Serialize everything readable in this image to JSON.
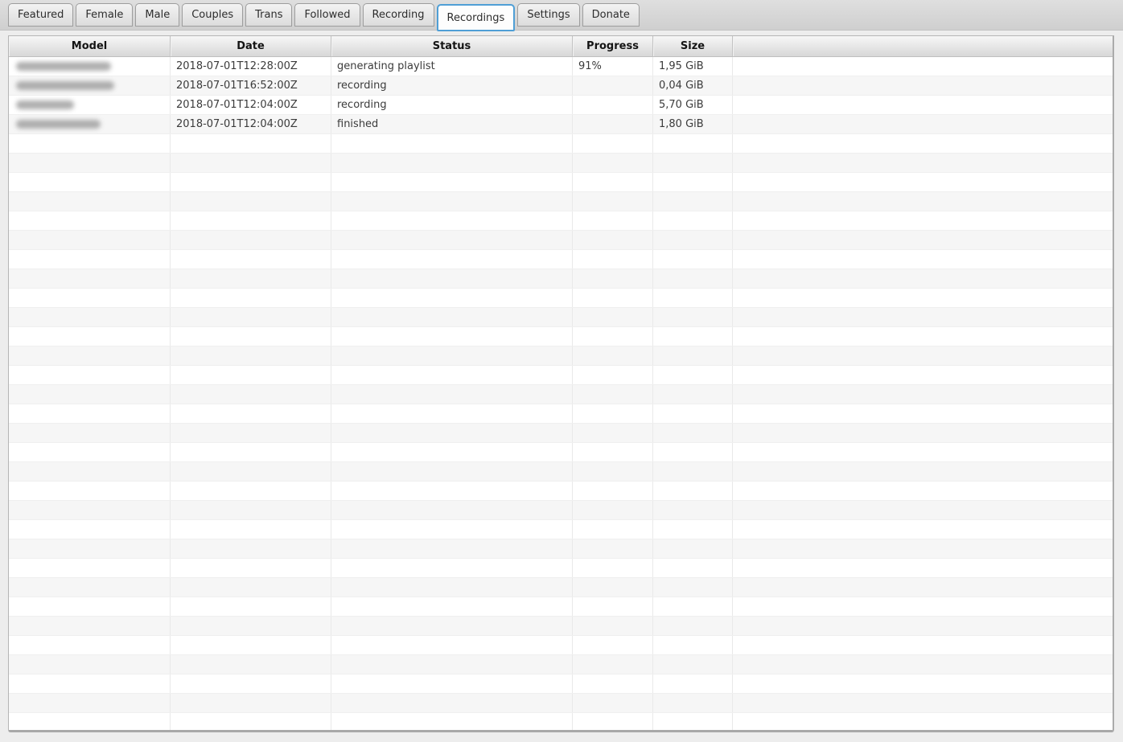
{
  "tabs": {
    "items": [
      {
        "label": "Featured",
        "active": false
      },
      {
        "label": "Female",
        "active": false
      },
      {
        "label": "Male",
        "active": false
      },
      {
        "label": "Couples",
        "active": false
      },
      {
        "label": "Trans",
        "active": false
      },
      {
        "label": "Followed",
        "active": false
      },
      {
        "label": "Recording",
        "active": false
      },
      {
        "label": "Recordings",
        "active": true
      },
      {
        "label": "Settings",
        "active": false
      },
      {
        "label": "Donate",
        "active": false
      }
    ]
  },
  "table": {
    "columns": [
      {
        "label": "Model"
      },
      {
        "label": "Date"
      },
      {
        "label": "Status"
      },
      {
        "label": "Progress"
      },
      {
        "label": "Size"
      },
      {
        "label": ""
      }
    ],
    "rows": [
      {
        "model": "",
        "model_redacted": true,
        "model_blob_width": 118,
        "date": "2018-07-01T12:28:00Z",
        "status": "generating playlist",
        "progress": "91%",
        "size": "1,95 GiB"
      },
      {
        "model": "",
        "model_redacted": true,
        "model_blob_width": 122,
        "date": "2018-07-01T16:52:00Z",
        "status": "recording",
        "progress": "",
        "size": "0,04 GiB"
      },
      {
        "model": "",
        "model_redacted": true,
        "model_blob_width": 72,
        "date": "2018-07-01T12:04:00Z",
        "status": "recording",
        "progress": "",
        "size": "5,70 GiB"
      },
      {
        "model": "",
        "model_redacted": true,
        "model_blob_width": 105,
        "date": "2018-07-01T12:04:00Z",
        "status": "finished",
        "progress": "",
        "size": "1,80 GiB"
      }
    ],
    "empty_row_count": 31
  },
  "colors": {
    "active_tab_border": "#4f9fd6",
    "tabbar_background": "#d6d6d6",
    "header_gradient_top": "#f7f7f7",
    "header_gradient_bottom": "#d7d7d7",
    "row_stripe": "#f6f6f6",
    "page_background": "#ededed"
  }
}
